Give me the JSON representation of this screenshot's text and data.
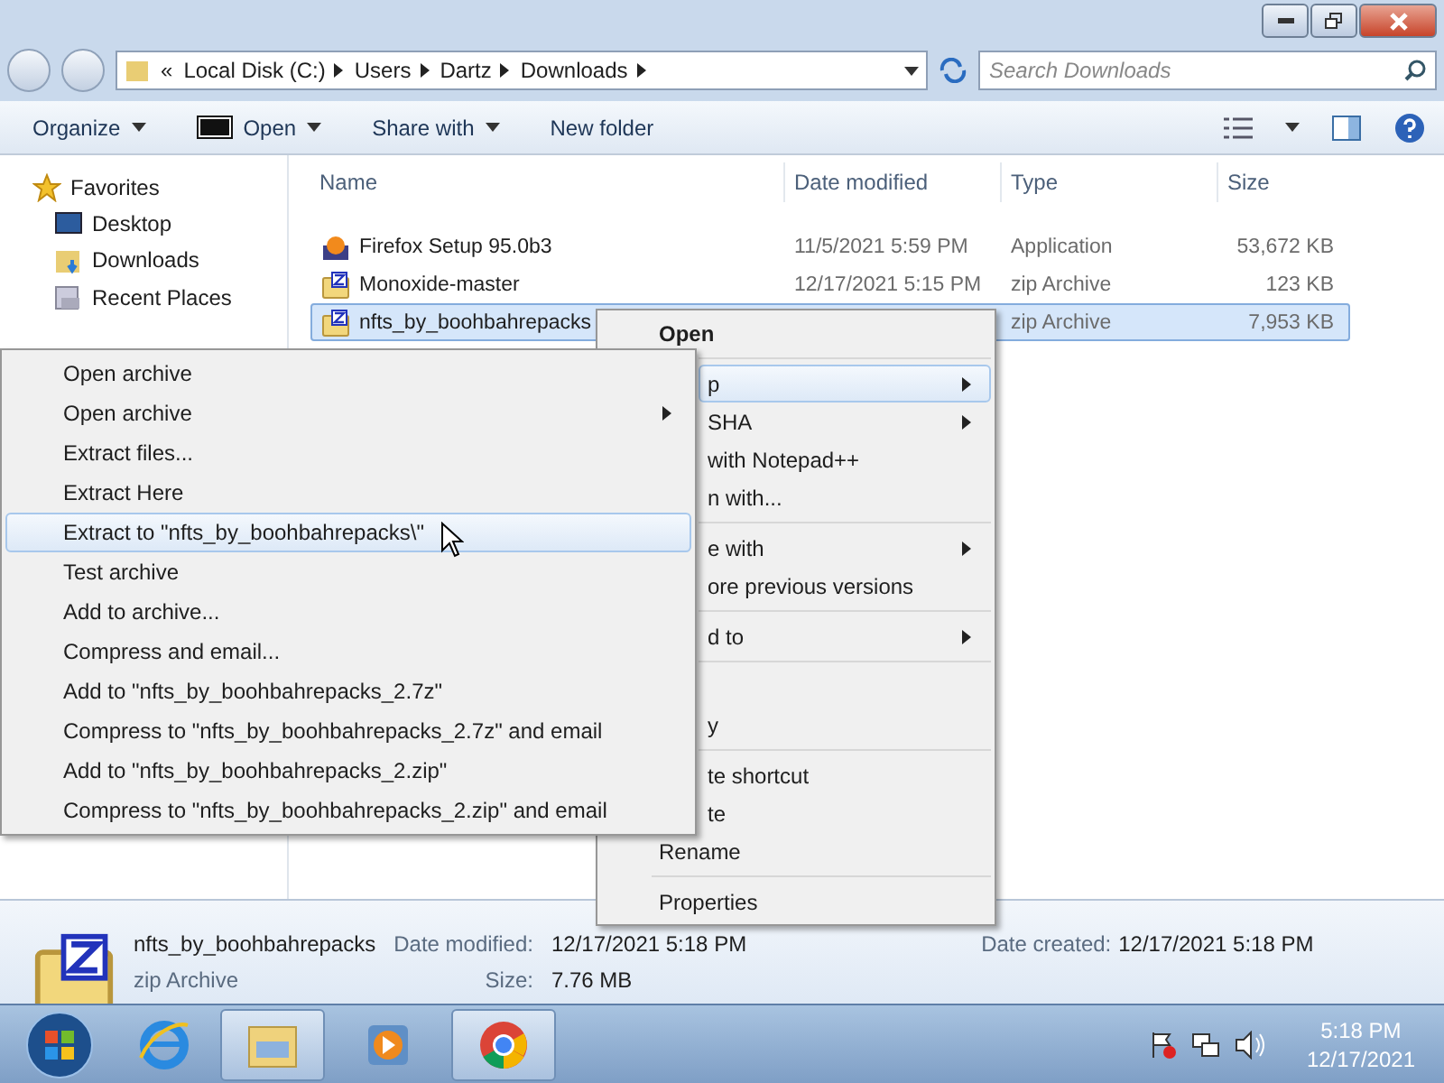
{
  "address": {
    "overflow": "«",
    "crumbs": [
      "Local Disk (C:)",
      "Users",
      "Dartz",
      "Downloads"
    ]
  },
  "search": {
    "placeholder": "Search Downloads"
  },
  "toolbar": [
    {
      "label": "Organize",
      "dropdown": true,
      "kind": "plain"
    },
    {
      "label": "Open",
      "dropdown": true,
      "kind": "zip"
    },
    {
      "label": "Share with",
      "dropdown": true,
      "kind": "plain"
    },
    {
      "label": "New folder",
      "dropdown": false,
      "kind": "plain"
    }
  ],
  "sidebar": {
    "heading": "Favorites",
    "items": [
      {
        "label": "Desktop",
        "kind": "desktop"
      },
      {
        "label": "Downloads",
        "kind": "downloads"
      },
      {
        "label": "Recent Places",
        "kind": "recent"
      }
    ]
  },
  "table": {
    "columns": [
      "Name",
      "Date modified",
      "Type",
      "Size"
    ],
    "rows": [
      {
        "name": "Firefox Setup 95.0b3",
        "date": "11/5/2021 5:59 PM",
        "type": "Application",
        "size": "53,672 KB",
        "kind": "app",
        "selected": false
      },
      {
        "name": "Monoxide-master",
        "date": "12/17/2021 5:15 PM",
        "type": "zip Archive",
        "size": "123 KB",
        "kind": "zip",
        "selected": false
      },
      {
        "name": "nfts_by_boohbahrepacks",
        "type": "zip Archive",
        "size": "7,953 KB",
        "kind": "zip",
        "selected": true
      }
    ]
  },
  "context_menu": [
    {
      "label": "Open",
      "bold": true,
      "clipped": false,
      "submenu": false,
      "highlighted": false,
      "separator": false
    },
    {
      "label": "p",
      "bold": false,
      "clipped": true,
      "submenu": true,
      "highlighted": true,
      "separator": true
    },
    {
      "label": "SHA",
      "bold": false,
      "clipped": true,
      "submenu": true,
      "highlighted": false,
      "separator": false
    },
    {
      "label": "with Notepad++",
      "bold": false,
      "clipped": true,
      "submenu": false,
      "highlighted": false,
      "separator": false
    },
    {
      "label": "n with...",
      "bold": false,
      "clipped": true,
      "submenu": false,
      "highlighted": false,
      "separator": false
    },
    {
      "label": "e with",
      "bold": false,
      "clipped": true,
      "submenu": true,
      "highlighted": false,
      "separator": true
    },
    {
      "label": "ore previous versions",
      "bold": false,
      "clipped": true,
      "submenu": false,
      "highlighted": false,
      "separator": false
    },
    {
      "label": "d to",
      "bold": false,
      "clipped": true,
      "submenu": true,
      "highlighted": false,
      "separator": true
    },
    {
      "label": "y",
      "bold": false,
      "clipped": true,
      "submenu": false,
      "highlighted": false,
      "separator": true,
      "gap_before": true
    },
    {
      "label": "te shortcut",
      "bold": false,
      "clipped": true,
      "submenu": false,
      "highlighted": false,
      "separator": true
    },
    {
      "label": "te",
      "bold": false,
      "clipped": true,
      "submenu": false,
      "highlighted": false,
      "separator": false
    },
    {
      "label": "Rename",
      "bold": false,
      "clipped": false,
      "submenu": false,
      "highlighted": false,
      "separator": false
    },
    {
      "label": "Properties",
      "bold": false,
      "clipped": false,
      "submenu": false,
      "highlighted": false,
      "separator": true
    }
  ],
  "submenu": [
    {
      "label": "Open archive",
      "submenu": false,
      "highlighted": false
    },
    {
      "label": "Open archive",
      "submenu": true,
      "highlighted": false
    },
    {
      "label": "Extract files...",
      "submenu": false,
      "highlighted": false
    },
    {
      "label": "Extract Here",
      "submenu": false,
      "highlighted": false
    },
    {
      "label": "Extract to \"nfts_by_boohbahrepacks\\\"",
      "submenu": false,
      "highlighted": true
    },
    {
      "label": "Test archive",
      "submenu": false,
      "highlighted": false
    },
    {
      "label": "Add to archive...",
      "submenu": false,
      "highlighted": false
    },
    {
      "label": "Compress and email...",
      "submenu": false,
      "highlighted": false
    },
    {
      "label": "Add to \"nfts_by_boohbahrepacks_2.7z\"",
      "submenu": false,
      "highlighted": false
    },
    {
      "label": "Compress to \"nfts_by_boohbahrepacks_2.7z\" and email",
      "submenu": false,
      "highlighted": false
    },
    {
      "label": "Add to \"nfts_by_boohbahrepacks_2.zip\"",
      "submenu": false,
      "highlighted": false
    },
    {
      "label": "Compress to \"nfts_by_boohbahrepacks_2.zip\" and email",
      "submenu": false,
      "highlighted": false
    }
  ],
  "details": {
    "name": "nfts_by_boohbahrepacks",
    "type": "zip Archive",
    "fields": [
      {
        "label": "Date modified:",
        "value": "12/17/2021 5:18 PM"
      },
      {
        "label": "Size:",
        "value": "7.76 MB"
      },
      {
        "label": "Date created:",
        "value": "12/17/2021 5:18 PM"
      }
    ]
  },
  "taskbar": {
    "apps": [
      {
        "kind": "ie",
        "active": false
      },
      {
        "kind": "explorer",
        "active": true
      },
      {
        "kind": "media",
        "active": false
      },
      {
        "kind": "chrome",
        "active": true
      }
    ],
    "time": "5:18 PM",
    "date": "12/17/2021"
  }
}
